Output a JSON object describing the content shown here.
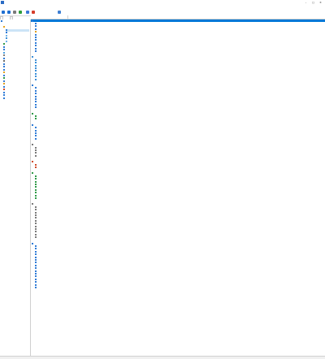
{
  "window": {
    "title": ""
  },
  "menus": [
    {
      "id": "menu-file",
      "label": ""
    },
    {
      "id": "menu-view",
      "label": ""
    },
    {
      "id": "menu-report",
      "label": ""
    },
    {
      "id": "menu-favorites",
      "label": ""
    },
    {
      "id": "menu-tools",
      "label": ""
    },
    {
      "id": "menu-help",
      "label": ""
    }
  ],
  "toolbar": {
    "buttons": [
      {
        "id": "back",
        "icon": "arrow-left-icon",
        "color": "#1f6fd1"
      },
      {
        "id": "forward",
        "icon": "arrow-right-icon",
        "color": "#1f6fd1"
      },
      {
        "id": "up",
        "icon": "arrow-up-icon",
        "color": "#7a7a7a"
      },
      {
        "id": "refresh",
        "icon": "refresh-icon",
        "color": "#2e9e3a"
      },
      {
        "id": "user",
        "icon": "user-icon",
        "color": "#3b78d8"
      },
      {
        "id": "chart",
        "icon": "chart-icon",
        "color": "#d53d2a"
      },
      {
        "id": "report",
        "icon": "report-icon",
        "color": "#3f7fd3"
      }
    ],
    "report_label": ""
  },
  "tabs": [
    {
      "label": "",
      "selected": true
    },
    {
      "label": "",
      "selected": false
    }
  ],
  "tree": [
    {
      "label": "",
      "indent": 0,
      "color": "#2f7bd6",
      "selected": false
    },
    {
      "label": "",
      "indent": 1,
      "color": "#ffffff",
      "selected": false
    },
    {
      "label": "",
      "indent": 1,
      "color": "#e8a21c",
      "selected": false
    },
    {
      "label": "",
      "indent": 2,
      "color": "#2f7bd6",
      "selected": true
    },
    {
      "label": "",
      "indent": 2,
      "color": "#2f7bd6",
      "selected": false
    },
    {
      "label": "",
      "indent": 2,
      "color": "#6fb3e8",
      "selected": false
    },
    {
      "label": "",
      "indent": 2,
      "color": "#3a8fd8",
      "selected": false
    },
    {
      "label": "",
      "indent": 2,
      "color": "#6fb3e8",
      "selected": false
    },
    {
      "label": "",
      "indent": 1,
      "color": "#2f9a48",
      "selected": false
    },
    {
      "label": "",
      "indent": 1,
      "color": "#2f7bd6",
      "selected": false
    },
    {
      "label": "",
      "indent": 1,
      "color": "#2f7bd6",
      "selected": false
    },
    {
      "label": "",
      "indent": 1,
      "color": "#4aa0e0",
      "selected": false
    },
    {
      "label": "",
      "indent": 1,
      "color": "#7a7a7a",
      "selected": false
    },
    {
      "label": "",
      "indent": 1,
      "color": "#2f7bd6",
      "selected": false
    },
    {
      "label": "",
      "indent": 1,
      "color": "#6a6a6a",
      "selected": false
    },
    {
      "label": "",
      "indent": 1,
      "color": "#2f7bd6",
      "selected": false
    },
    {
      "label": "",
      "indent": 1,
      "color": "#2f7bd6",
      "selected": false
    },
    {
      "label": "",
      "indent": 1,
      "color": "#2f7bd6",
      "selected": false
    },
    {
      "label": "",
      "indent": 1,
      "color": "#e0a020",
      "selected": false
    },
    {
      "label": "",
      "indent": 1,
      "color": "#2f7bd6",
      "selected": false
    },
    {
      "label": "",
      "indent": 1,
      "color": "#2f9a48",
      "selected": false
    },
    {
      "label": "",
      "indent": 1,
      "color": "#3a7bd0",
      "selected": false
    },
    {
      "label": "",
      "indent": 1,
      "color": "#e0a020",
      "selected": false
    },
    {
      "label": "",
      "indent": 1,
      "color": "#2f7bd6",
      "selected": false
    },
    {
      "label": "",
      "indent": 1,
      "color": "#d04a2a",
      "selected": false
    },
    {
      "label": "",
      "indent": 1,
      "color": "#2f7bd6",
      "selected": false
    },
    {
      "label": "",
      "indent": 1,
      "color": "#2f7bd6",
      "selected": false
    },
    {
      "label": "",
      "indent": 1,
      "color": "#2f7bd6",
      "selected": false
    }
  ],
  "columns": {
    "field": "",
    "value": ""
  },
  "rows": [
    {
      "kind": "section",
      "field": "",
      "value": "",
      "color": "#2f7bd6",
      "selected": true,
      "link": false
    },
    {
      "kind": "row",
      "field": "",
      "value": "",
      "color": "#2f7bd6",
      "selected": false,
      "link": false
    },
    {
      "kind": "row",
      "field": "",
      "value": "",
      "color": "#2f7bd6",
      "selected": false,
      "link": true
    },
    {
      "kind": "row",
      "field": "",
      "value": "",
      "color": "#2f7bd6",
      "selected": false,
      "link": false
    },
    {
      "kind": "row",
      "field": "",
      "value": "",
      "color": "#e0a020",
      "selected": false,
      "link": false
    },
    {
      "kind": "row",
      "field": "",
      "value": "",
      "color": "#2f7bd6",
      "selected": false,
      "link": false
    },
    {
      "kind": "row",
      "field": "",
      "value": "",
      "color": "#2f7bd6",
      "selected": false,
      "link": false
    },
    {
      "kind": "row",
      "field": "",
      "value": "",
      "color": "#2f7bd6",
      "selected": false,
      "link": false
    },
    {
      "kind": "row",
      "field": "",
      "value": "",
      "color": "#2f7bd6",
      "selected": false,
      "link": false
    },
    {
      "kind": "row",
      "field": "",
      "value": "",
      "color": "#2f7bd6",
      "selected": false,
      "link": false
    },
    {
      "kind": "row",
      "field": "",
      "value": "",
      "color": "#2f7bd6",
      "selected": false,
      "link": false
    },
    {
      "kind": "row",
      "field": "",
      "value": "",
      "color": "#2f7bd6",
      "selected": false,
      "link": false
    },
    {
      "kind": "spacer"
    },
    {
      "kind": "section",
      "field": "",
      "value": "",
      "color": "#3a8fd8",
      "selected": false,
      "link": false
    },
    {
      "kind": "row",
      "field": "",
      "value": "",
      "color": "#3a8fd8",
      "selected": false,
      "link": true
    },
    {
      "kind": "row",
      "field": "",
      "value": "",
      "color": "#3a8fd8",
      "selected": false,
      "link": true
    },
    {
      "kind": "row",
      "field": "",
      "value": "",
      "color": "#3a8fd8",
      "selected": false,
      "link": false
    },
    {
      "kind": "row",
      "field": "",
      "value": "",
      "color": "#3a8fd8",
      "selected": false,
      "link": false
    },
    {
      "kind": "row",
      "field": "",
      "value": "",
      "color": "#3a8fd8",
      "selected": false,
      "link": true
    },
    {
      "kind": "row",
      "field": "",
      "value": "",
      "color": "#3a8fd8",
      "selected": false,
      "link": true
    },
    {
      "kind": "row",
      "field": "",
      "value": "",
      "color": "#3a8fd8",
      "selected": false,
      "link": false
    },
    {
      "kind": "row",
      "field": "",
      "value": "",
      "color": "#3a8fd8",
      "selected": false,
      "link": false
    },
    {
      "kind": "spacer"
    },
    {
      "kind": "section",
      "field": "",
      "value": "",
      "color": "#2f7bd6",
      "selected": false,
      "link": false
    },
    {
      "kind": "row",
      "field": "",
      "value": "",
      "color": "#2f7bd6",
      "selected": false,
      "link": true
    },
    {
      "kind": "row",
      "field": "",
      "value": "",
      "color": "#2f7bd6",
      "selected": false,
      "link": true
    },
    {
      "kind": "row",
      "field": "",
      "value": "",
      "color": "#2f7bd6",
      "selected": false,
      "link": true
    },
    {
      "kind": "row",
      "field": "",
      "value": "",
      "color": "#2f7bd6",
      "selected": false,
      "link": true
    },
    {
      "kind": "row",
      "field": "",
      "value": "",
      "color": "#2f7bd6",
      "selected": false,
      "link": true
    },
    {
      "kind": "row",
      "field": "",
      "value": "",
      "color": "#2f7bd6",
      "selected": false,
      "link": true
    },
    {
      "kind": "row",
      "field": "",
      "value": "",
      "color": "#2f7bd6",
      "selected": false,
      "link": true
    },
    {
      "kind": "row",
      "field": "",
      "value": "",
      "color": "#2f7bd6",
      "selected": false,
      "link": true
    },
    {
      "kind": "spacer"
    },
    {
      "kind": "section",
      "field": "",
      "value": "",
      "color": "#2f9a48",
      "selected": false,
      "link": false
    },
    {
      "kind": "row",
      "field": "",
      "value": "",
      "color": "#2f9a48",
      "selected": false,
      "link": true
    },
    {
      "kind": "row",
      "field": "",
      "value": "",
      "color": "#2f9a48",
      "selected": false,
      "link": true
    },
    {
      "kind": "spacer"
    },
    {
      "kind": "section",
      "field": "",
      "value": "",
      "color": "#2f7bd6",
      "selected": false,
      "link": false
    },
    {
      "kind": "row",
      "field": "",
      "value": "",
      "color": "#2f7bd6",
      "selected": false,
      "link": false
    },
    {
      "kind": "row",
      "field": "",
      "value": "",
      "color": "#2f7bd6",
      "selected": false,
      "link": false
    },
    {
      "kind": "row",
      "field": "",
      "value": "",
      "color": "#2f7bd6",
      "selected": false,
      "link": true
    },
    {
      "kind": "row",
      "field": "",
      "value": "",
      "color": "#2f7bd6",
      "selected": false,
      "link": true
    },
    {
      "kind": "row",
      "field": "",
      "value": "",
      "color": "#2f7bd6",
      "selected": false,
      "link": true
    },
    {
      "kind": "spacer"
    },
    {
      "kind": "section",
      "field": "",
      "value": "",
      "color": "#7a7a7a",
      "selected": false,
      "link": false
    },
    {
      "kind": "row",
      "field": "",
      "value": "",
      "color": "#7a7a7a",
      "selected": false,
      "link": false
    },
    {
      "kind": "row",
      "field": "",
      "value": "",
      "color": "#7a7a7a",
      "selected": false,
      "link": false
    },
    {
      "kind": "row",
      "field": "",
      "value": "",
      "color": "#7a7a7a",
      "selected": false,
      "link": false
    },
    {
      "kind": "row",
      "field": "",
      "value": "",
      "color": "#7a7a7a",
      "selected": false,
      "link": false
    },
    {
      "kind": "spacer"
    },
    {
      "kind": "section",
      "field": "",
      "value": "",
      "color": "#d04a2a",
      "selected": false,
      "link": false
    },
    {
      "kind": "row",
      "field": "",
      "value": "",
      "color": "#d04a2a",
      "selected": false,
      "link": false
    },
    {
      "kind": "row",
      "field": "",
      "value": "",
      "color": "#d04a2a",
      "selected": false,
      "link": false
    },
    {
      "kind": "spacer"
    },
    {
      "kind": "section",
      "field": "",
      "value": "",
      "color": "#2f9a48",
      "selected": false,
      "link": false
    },
    {
      "kind": "row",
      "field": "",
      "value": "",
      "color": "#2f9a48",
      "selected": false,
      "link": false
    },
    {
      "kind": "row",
      "field": "",
      "value": "",
      "color": "#2f9a48",
      "selected": false,
      "link": false
    },
    {
      "kind": "row",
      "field": "",
      "value": "",
      "color": "#2f9a48",
      "selected": false,
      "link": false
    },
    {
      "kind": "row",
      "field": "",
      "value": "",
      "color": "#2f9a48",
      "selected": false,
      "link": false
    },
    {
      "kind": "row",
      "field": "",
      "value": "",
      "color": "#2f9a48",
      "selected": false,
      "link": false
    },
    {
      "kind": "row",
      "field": "",
      "value": "",
      "color": "#2f9a48",
      "selected": false,
      "link": false
    },
    {
      "kind": "row",
      "field": "",
      "value": "",
      "color": "#2f9a48",
      "selected": false,
      "link": true
    },
    {
      "kind": "row",
      "field": "",
      "value": "",
      "color": "#2f9a48",
      "selected": false,
      "link": true
    },
    {
      "kind": "row",
      "field": "",
      "value": "",
      "color": "#2f9a48",
      "selected": false,
      "link": true
    },
    {
      "kind": "spacer"
    },
    {
      "kind": "section",
      "field": "",
      "value": "",
      "color": "#7a7a7a",
      "selected": false,
      "link": false
    },
    {
      "kind": "row",
      "field": "",
      "value": "",
      "color": "#7a7a7a",
      "selected": false,
      "link": false
    },
    {
      "kind": "row",
      "field": "",
      "value": "",
      "color": "#7a7a7a",
      "selected": false,
      "link": true
    },
    {
      "kind": "row",
      "field": "",
      "value": "",
      "color": "#7a7a7a",
      "selected": false,
      "link": false
    },
    {
      "kind": "row",
      "field": "",
      "value": "",
      "color": "#7a7a7a",
      "selected": false,
      "link": false
    },
    {
      "kind": "row",
      "field": "",
      "value": "",
      "color": "#7a7a7a",
      "selected": false,
      "link": true
    },
    {
      "kind": "row",
      "field": "",
      "value": "",
      "color": "#7a7a7a",
      "selected": false,
      "link": false
    },
    {
      "kind": "row",
      "field": "",
      "value": "",
      "color": "#7a7a7a",
      "selected": false,
      "link": false
    },
    {
      "kind": "row",
      "field": "",
      "value": "",
      "color": "#7a7a7a",
      "selected": false,
      "link": false
    },
    {
      "kind": "row",
      "field": "",
      "value": "",
      "color": "#7a7a7a",
      "selected": false,
      "link": false
    },
    {
      "kind": "row",
      "field": "",
      "value": "",
      "color": "#7a7a7a",
      "selected": false,
      "link": false
    },
    {
      "kind": "row",
      "field": "",
      "value": "",
      "color": "#7a7a7a",
      "selected": false,
      "link": false
    },
    {
      "kind": "row",
      "field": "",
      "value": "",
      "color": "#7a7a7a",
      "selected": false,
      "link": false
    },
    {
      "kind": "spacer"
    },
    {
      "kind": "section",
      "field": "",
      "value": "",
      "color": "#2f7bd6",
      "selected": false,
      "link": false
    },
    {
      "kind": "row",
      "field": "",
      "value": "",
      "color": "#2f7bd6",
      "selected": false,
      "link": true
    },
    {
      "kind": "row",
      "field": "",
      "value": "",
      "color": "#2f7bd6",
      "selected": false,
      "link": false
    },
    {
      "kind": "row",
      "field": "",
      "value": "",
      "color": "#2f7bd6",
      "selected": false,
      "link": false
    },
    {
      "kind": "row",
      "field": "",
      "value": "",
      "color": "#2f7bd6",
      "selected": false,
      "link": false
    },
    {
      "kind": "row",
      "field": "",
      "value": "",
      "color": "#2f7bd6",
      "selected": false,
      "link": false
    },
    {
      "kind": "row",
      "field": "",
      "value": "",
      "color": "#2f7bd6",
      "selected": false,
      "link": false
    },
    {
      "kind": "row",
      "field": "",
      "value": "",
      "color": "#2f7bd6",
      "selected": false,
      "link": false
    },
    {
      "kind": "row",
      "field": "",
      "value": "",
      "color": "#2f7bd6",
      "selected": false,
      "link": false
    },
    {
      "kind": "row",
      "field": "",
      "value": "",
      "color": "#2f7bd6",
      "selected": false,
      "link": false
    },
    {
      "kind": "row",
      "field": "",
      "value": "",
      "color": "#2f7bd6",
      "selected": false,
      "link": false
    },
    {
      "kind": "row",
      "field": "",
      "value": "",
      "color": "#2f7bd6",
      "selected": false,
      "link": false
    },
    {
      "kind": "row",
      "field": "",
      "value": "",
      "color": "#2f7bd6",
      "selected": false,
      "link": false
    },
    {
      "kind": "row",
      "field": "",
      "value": "",
      "color": "#2f7bd6",
      "selected": false,
      "link": false
    },
    {
      "kind": "row",
      "field": "",
      "value": "",
      "color": "#2f7bd6",
      "selected": false,
      "link": false
    },
    {
      "kind": "row",
      "field": "",
      "value": "",
      "color": "#2f7bd6",
      "selected": false,
      "link": false
    },
    {
      "kind": "row",
      "field": "",
      "value": "",
      "color": "#2f7bd6",
      "selected": false,
      "link": false
    }
  ],
  "status": {
    "left": "",
    "right": ""
  },
  "colors": {
    "selection": "#0078d7",
    "link": "#0645ad",
    "tree_selection": "#cce4f7"
  }
}
